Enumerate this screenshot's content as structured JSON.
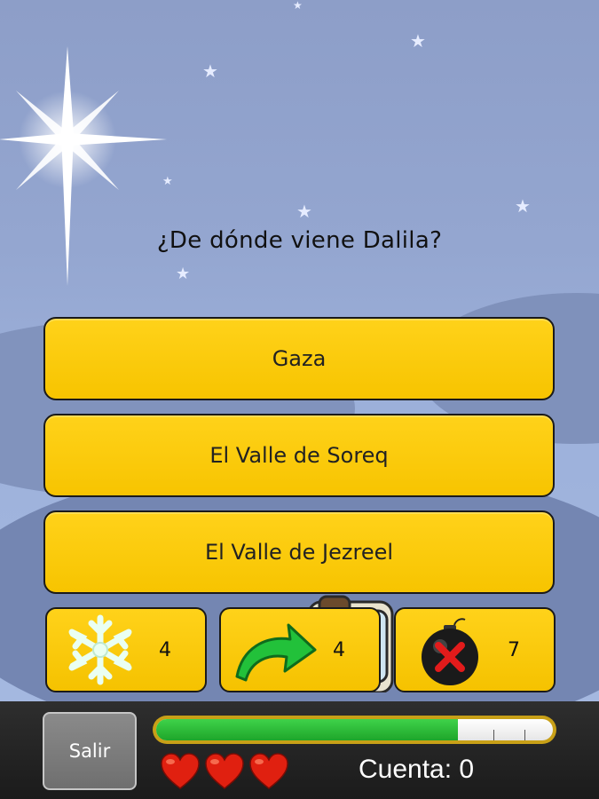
{
  "question": {
    "text": "¿De dónde viene Dalila?"
  },
  "answers": [
    {
      "label": "Gaza"
    },
    {
      "label": "El Valle de Soreq"
    },
    {
      "label": "El Valle de Jezreel"
    }
  ],
  "powerups": [
    {
      "icon": "snowflake-icon",
      "count": "4"
    },
    {
      "icon": "skip-arrow-icon",
      "count": "4"
    },
    {
      "icon": "bomb-icon",
      "count": "7"
    }
  ],
  "bottom_bar": {
    "exit_label": "Salir",
    "timer_progress": 0.76,
    "lives": 3,
    "score_text": "Cuenta: 0"
  },
  "colors": {
    "answer_yellow": "#f7c400",
    "timer_green": "#1ea52a",
    "heart_red": "#e02010",
    "sky_blue": "#94a6d0"
  }
}
